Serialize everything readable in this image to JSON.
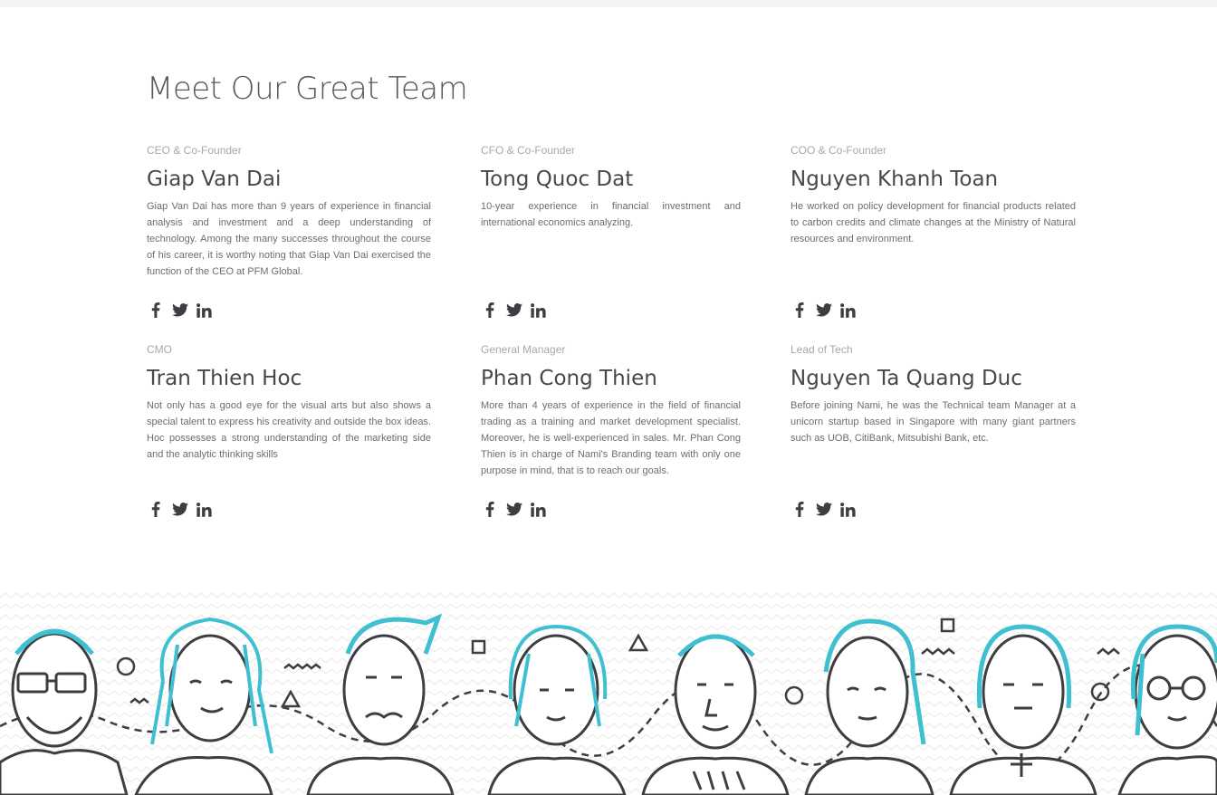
{
  "section": {
    "title": "Meet Our Great Team"
  },
  "colors": {
    "accent": "#3fc0d0",
    "line": "#3d3e42",
    "text": "#45484c",
    "muted": "#a5a8ab"
  },
  "members": [
    {
      "role": "CEO & Co-Founder",
      "name": "Giap Van Dai",
      "bio": "Giap Van Dai has more than 9 years of experience in financial analysis and investment and a deep understanding of technology. Among the many successes throughout the course of his career, it is worthy noting that Giap Van Dai exercised the function of the CEO at PFM Global."
    },
    {
      "role": "CFO & Co-Founder",
      "name": "Tong Quoc Dat",
      "bio": "10-year experience in financial investment and international economics analyzing."
    },
    {
      "role": "COO & Co-Founder",
      "name": "Nguyen Khanh Toan",
      "bio": "He worked on policy development for financial products related to carbon credits and climate changes at the Ministry of Natural resources and environment."
    },
    {
      "role": "CMO",
      "name": "Tran Thien Hoc",
      "bio": "Not only has a good eye for the visual arts but also shows a special talent to express his creativity and outside the box ideas. Hoc possesses a strong understanding of the marketing side and the analytic thinking skills"
    },
    {
      "role": "General Manager",
      "name": "Phan Cong Thien",
      "bio": "More than 4 years of experience in the field of financial trading as a training and market development specialist. Moreover, he is well-experienced in sales. Mr. Phan Cong Thien is in charge of Nami's Branding team with only one purpose in mind, that is to reach our goals."
    },
    {
      "role": "Lead of Tech",
      "name": "Nguyen Ta Quang Duc",
      "bio": "Before joining Nami, he was the Technical team Manager at a unicorn startup based in Singapore with many giant partners such as UOB, CitiBank, Mitsubishi Bank, etc."
    }
  ],
  "social_icons": [
    "facebook-icon",
    "twitter-icon",
    "linkedin-icon"
  ]
}
